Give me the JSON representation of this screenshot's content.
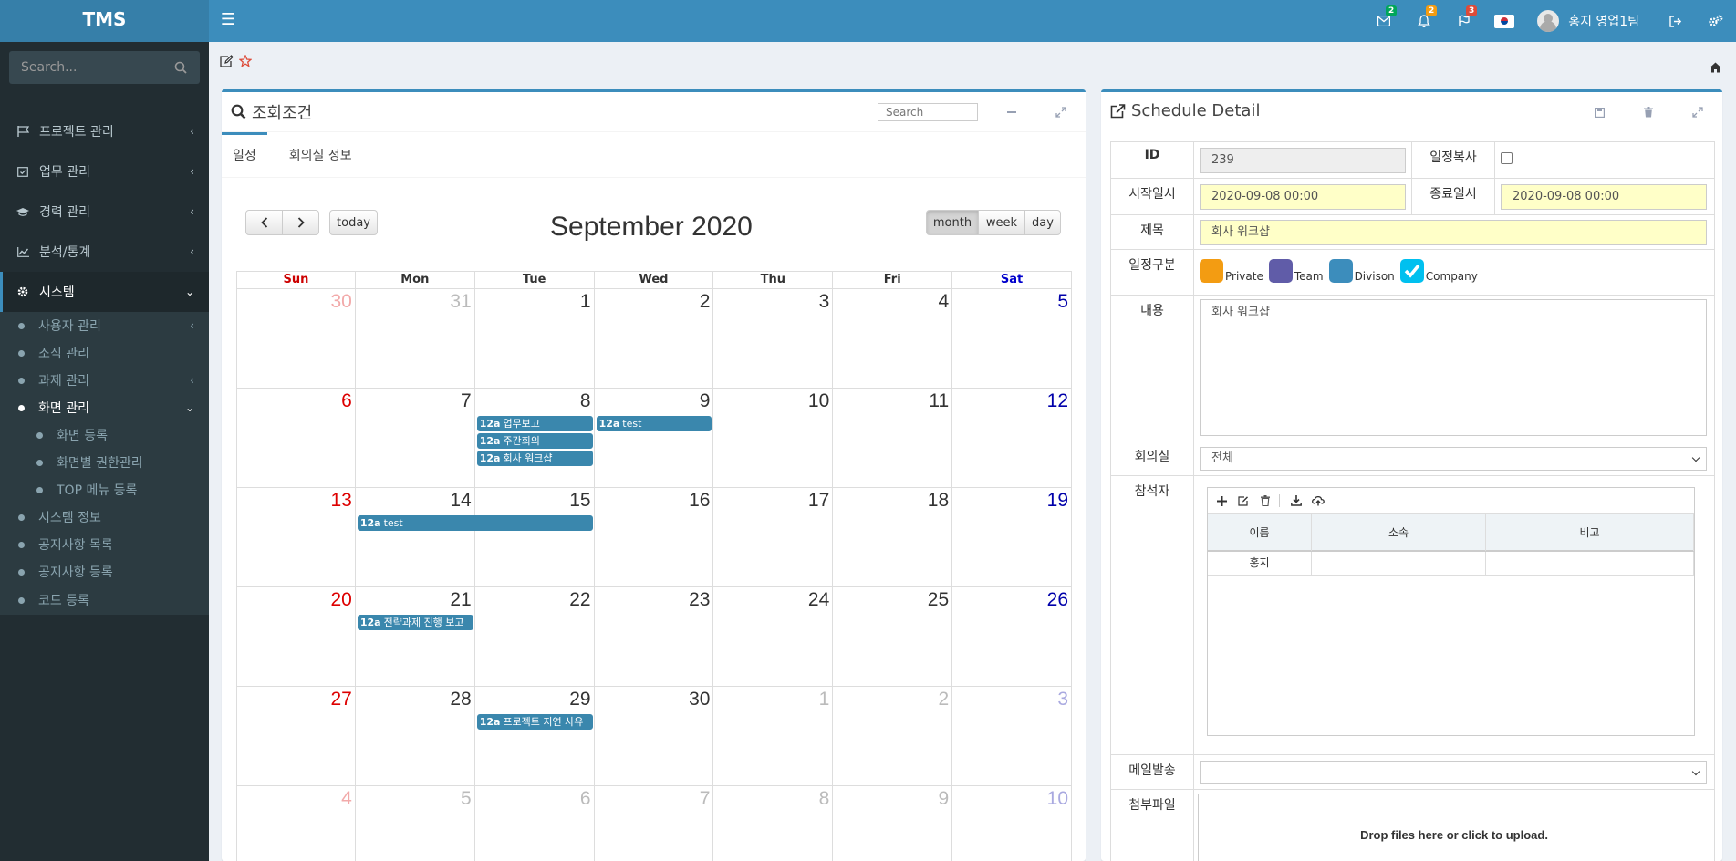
{
  "app": {
    "logo": "TMS"
  },
  "header": {
    "badges": {
      "mail": "2",
      "bell": "2",
      "flag": "3"
    },
    "user_name": "홍지 영업1팀"
  },
  "sidebar": {
    "search_placeholder": "Search...",
    "menu": [
      {
        "label": "프로젝트 관리",
        "icon": "flag-icon"
      },
      {
        "label": "업무 관리",
        "icon": "calendar-check-icon"
      },
      {
        "label": "경력 관리",
        "icon": "graduation-cap-icon"
      },
      {
        "label": "분석/통계",
        "icon": "line-chart-icon"
      },
      {
        "label": "시스템",
        "icon": "gear-icon"
      }
    ],
    "system_sub": [
      {
        "label": "사용자 관리"
      },
      {
        "label": "조직 관리"
      },
      {
        "label": "과제 관리"
      },
      {
        "label": "화면 관리"
      },
      {
        "label": "화면 등록"
      },
      {
        "label": "화면별 권한관리"
      },
      {
        "label": "TOP 메뉴 등록"
      },
      {
        "label": "시스템 정보"
      },
      {
        "label": "공지사항 목록"
      },
      {
        "label": "공지사항 등록"
      },
      {
        "label": "코드 등록"
      }
    ]
  },
  "left_panel": {
    "title": "조회조건",
    "search_placeholder": "Search",
    "tabs": [
      "일정",
      "회의실 정보"
    ]
  },
  "calendar": {
    "title": "September 2020",
    "today_label": "today",
    "views": [
      "month",
      "week",
      "day"
    ],
    "active_view": "month",
    "dow": [
      "Sun",
      "Mon",
      "Tue",
      "Wed",
      "Thu",
      "Fri",
      "Sat"
    ],
    "weeks": [
      [
        {
          "d": "30",
          "o": true
        },
        {
          "d": "31",
          "o": true
        },
        {
          "d": "1"
        },
        {
          "d": "2"
        },
        {
          "d": "3"
        },
        {
          "d": "4"
        },
        {
          "d": "5"
        }
      ],
      [
        {
          "d": "6"
        },
        {
          "d": "7"
        },
        {
          "d": "8"
        },
        {
          "d": "9"
        },
        {
          "d": "10"
        },
        {
          "d": "11"
        },
        {
          "d": "12"
        }
      ],
      [
        {
          "d": "13"
        },
        {
          "d": "14"
        },
        {
          "d": "15"
        },
        {
          "d": "16"
        },
        {
          "d": "17"
        },
        {
          "d": "18"
        },
        {
          "d": "19"
        }
      ],
      [
        {
          "d": "20"
        },
        {
          "d": "21"
        },
        {
          "d": "22"
        },
        {
          "d": "23"
        },
        {
          "d": "24"
        },
        {
          "d": "25"
        },
        {
          "d": "26"
        }
      ],
      [
        {
          "d": "27"
        },
        {
          "d": "28"
        },
        {
          "d": "29"
        },
        {
          "d": "30"
        },
        {
          "d": "1",
          "o": true
        },
        {
          "d": "2",
          "o": true
        },
        {
          "d": "3",
          "o": true
        }
      ],
      [
        {
          "d": "4",
          "o": true
        },
        {
          "d": "5",
          "o": true
        },
        {
          "d": "6",
          "o": true
        },
        {
          "d": "7",
          "o": true
        },
        {
          "d": "8",
          "o": true
        },
        {
          "d": "9",
          "o": true
        },
        {
          "d": "10",
          "o": true
        }
      ]
    ],
    "events": [
      {
        "week": 1,
        "col": 2,
        "span": 1,
        "slot": 0,
        "time": "12a",
        "title": "업무보고"
      },
      {
        "week": 1,
        "col": 2,
        "span": 1,
        "slot": 1,
        "time": "12a",
        "title": "주간회의"
      },
      {
        "week": 1,
        "col": 2,
        "span": 1,
        "slot": 2,
        "time": "12a",
        "title": "회사 워크샵"
      },
      {
        "week": 1,
        "col": 3,
        "span": 1,
        "slot": 0,
        "time": "12a",
        "title": "test"
      },
      {
        "week": 2,
        "col": 1,
        "span": 2,
        "slot": 0,
        "time": "12a",
        "title": "test"
      },
      {
        "week": 3,
        "col": 1,
        "span": 1,
        "slot": 0,
        "time": "12a",
        "title": "전략과제 진행 보고"
      },
      {
        "week": 4,
        "col": 2,
        "span": 1,
        "slot": 0,
        "time": "12a",
        "title": "프로젝트 지연 사유"
      }
    ]
  },
  "detail": {
    "title": "Schedule Detail",
    "labels": {
      "id": "ID",
      "copy": "일정복사",
      "start": "시작일시",
      "end": "종료일시",
      "subject": "제목",
      "category": "일정구분",
      "content": "내용",
      "room": "회의실",
      "attendees": "참석자",
      "mail": "메일발송",
      "files": "첨부파일"
    },
    "values": {
      "id": "239",
      "start": "2020-09-08 00:00",
      "end": "2020-09-08 00:00",
      "subject": "회사 워크샵",
      "content": "회사 워크샵",
      "room": "전체",
      "mail": ""
    },
    "categories": [
      {
        "label": "Private",
        "color": "#f39c12",
        "checked": false
      },
      {
        "label": "Team",
        "color": "#605ca8",
        "checked": false
      },
      {
        "label": "Divison",
        "color": "#3c8dbc",
        "checked": false
      },
      {
        "label": "Company",
        "color": "#00c0ef",
        "checked": true
      }
    ],
    "attendee_cols": [
      "이름",
      "소속",
      "비고"
    ],
    "attendees": [
      {
        "name": "홍지",
        "org": "",
        "note": ""
      }
    ],
    "dropzone": "Drop files here or click to upload."
  }
}
